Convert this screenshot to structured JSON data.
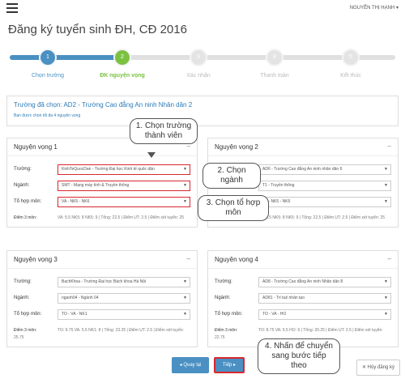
{
  "header": {
    "user": "NGUYỄN THỊ HẠNH ▾"
  },
  "page": {
    "title": "Đăng ký tuyển sinh ĐH, CĐ 2016"
  },
  "stepper": {
    "steps": [
      {
        "number": "1",
        "label": "Chọn trường",
        "state": "done"
      },
      {
        "number": "2",
        "label": "ĐK nguyện vọng",
        "state": "active"
      },
      {
        "number": "3",
        "label": "Xác nhận",
        "state": "pending"
      },
      {
        "number": "4",
        "label": "Thanh toán",
        "state": "pending"
      },
      {
        "number": "5",
        "label": "Kết thúc",
        "state": "pending"
      }
    ]
  },
  "info": {
    "title": "Trường đã chọn: AD2 - Trường Cao đẳng An ninh Nhân dân 2",
    "subtitle": "Bạn được chọn tối đa 4 nguyện vọng"
  },
  "labels": {
    "school": "Trường:",
    "major": "Ngành:",
    "combo": "Tổ hợp môn:",
    "scores": "Điểm 3 môn:",
    "collapse": "–"
  },
  "cards": [
    {
      "title": "Nguyện vọng 1",
      "school": "KinhTeQuocDan - Trường Đại học Kinh tế quốc dân",
      "major": "SMT - Mạng máy tính & Truyền thông",
      "combo": "VA - NK5 - NK6",
      "scores": "VA: 5.5 NK5: 8 NK5: 9 | Tổng: 22.5 | Điểm UT: 2.5 | Điểm xét tuyển: 25"
    },
    {
      "title": "Nguyện vọng 2",
      "school": "AD6 - Trường Cao đẳng An ninh nhân dân 6",
      "major": "T1 - Truyền thông",
      "combo": "VA - NK5 - NK6",
      "scores": "VA: 5.5 NK5: 8 NK5: 9 | Tổng: 22.5 | Điểm UT: 2.5 | Điểm xét tuyển: 25"
    },
    {
      "title": "Nguyện vọng 3",
      "school": "BachKhoa - Trường Đại học Bách khoa Hà Nội",
      "major": "nganh04 - Ngành 04",
      "combo": "TO - VA - NK1",
      "scores": "TO: 9.75 VA: 5.5 NK1: 8 | Tổng: 23.25 | Điểm UT: 2.5 | Điểm xét tuyển: 25.75"
    },
    {
      "title": "Nguyện vọng 4",
      "school": "AD8 - Trường Cao đẳng An ninh Nhân dân 8",
      "major": "AD81 - Trí tuệ nhân tạo",
      "combo": "TO - VA - HO",
      "scores": "TO: 8.75 VA: 5.5 HO: 6 | Tổng: 20.25 | Điểm UT: 2.5 | Điểm xét tuyển: 22.75"
    }
  ],
  "callouts": {
    "c1": "1. Chọn trường thành viên",
    "c2": "2. Chọn ngành",
    "c3": "3. Chọn tổ hợp môn",
    "c4": "4. Nhấn để chuyển sang bước tiếp theo"
  },
  "buttons": {
    "back": "◂ Quay lại",
    "next": "Tiếp ▸",
    "cancel": "✕ Hủy đăng ký"
  },
  "colors": {
    "primary": "#4a90c2",
    "active_step": "#7cc142",
    "highlight": "#d9272e"
  }
}
